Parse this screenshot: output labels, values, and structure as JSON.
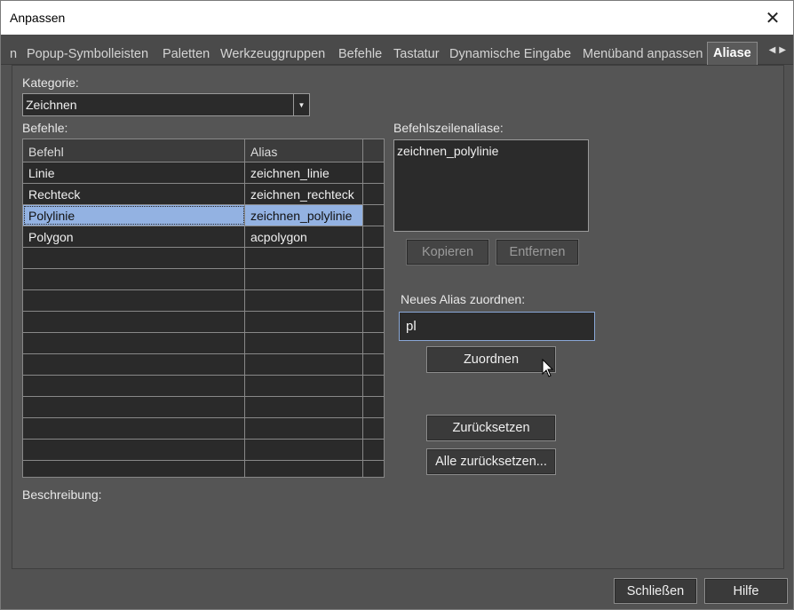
{
  "window": {
    "title": "Anpassen"
  },
  "tabs": [
    {
      "label": "n"
    },
    {
      "label": "Popup-Symbolleisten"
    },
    {
      "label": "Paletten"
    },
    {
      "label": "Werkzeuggruppen"
    },
    {
      "label": "Befehle"
    },
    {
      "label": "Tastatur"
    },
    {
      "label": "Dynamische Eingabe"
    },
    {
      "label": "Menüband anpassen"
    },
    {
      "label": "Aliase"
    }
  ],
  "category": {
    "label": "Kategorie:",
    "value": "Zeichnen"
  },
  "commands": {
    "label": "Befehle:",
    "columns": [
      "Befehl",
      "Alias"
    ],
    "rows": [
      {
        "befehl": "Linie",
        "alias": "zeichnen_linie"
      },
      {
        "befehl": "Rechteck",
        "alias": "zeichnen_rechteck"
      },
      {
        "befehl": "Polylinie",
        "alias": "zeichnen_polylinie",
        "selected": true
      },
      {
        "befehl": "Polygon",
        "alias": "acpolygon"
      }
    ]
  },
  "aliases": {
    "label": "Befehlszeilenaliase:",
    "items": [
      "zeichnen_polylinie"
    ]
  },
  "buttons": {
    "copy": "Kopieren",
    "remove": "Entfernen",
    "assign": "Zuordnen",
    "reset": "Zurücksetzen",
    "reset_all": "Alle zurücksetzen...",
    "close": "Schließen",
    "help": "Hilfe"
  },
  "new_alias": {
    "label": "Neues Alias zuordnen:",
    "value": "pl"
  },
  "description": {
    "label": "Beschreibung:"
  }
}
